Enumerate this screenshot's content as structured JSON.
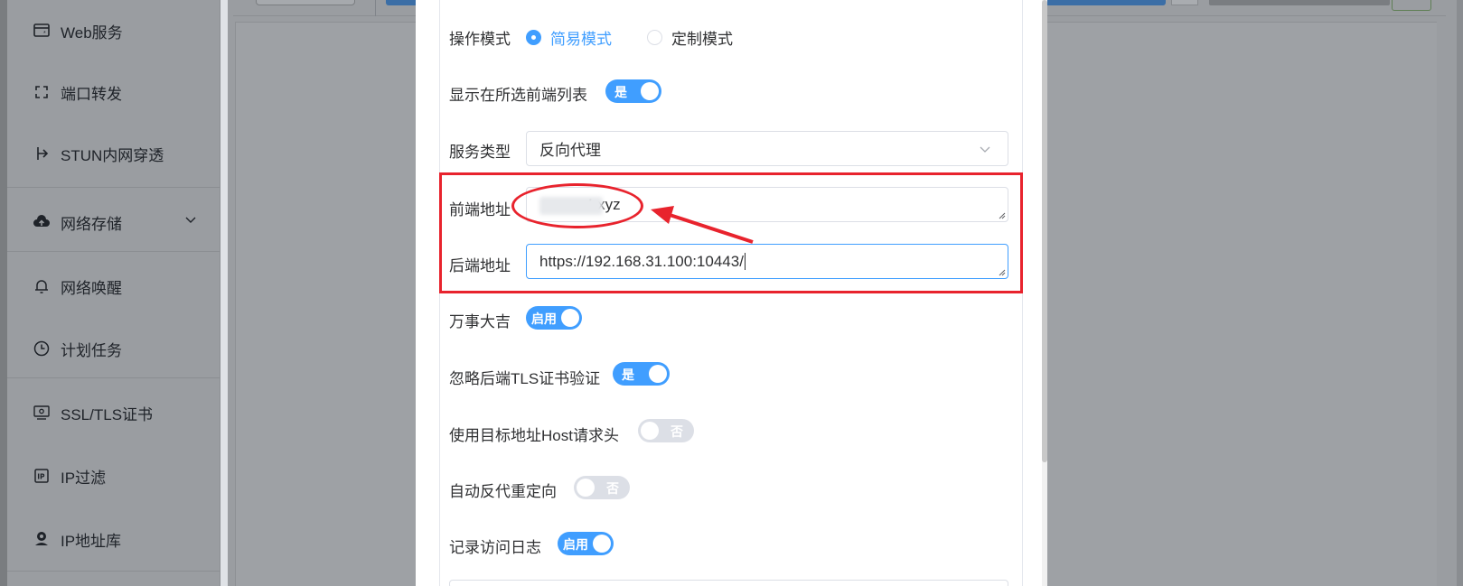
{
  "sidebar": {
    "items": [
      {
        "label": "Web服务",
        "icon": "web-service-icon"
      },
      {
        "label": "端口转发",
        "icon": "port-forward-icon"
      },
      {
        "label": "STUN内网穿透",
        "icon": "stun-icon"
      },
      {
        "label": "网络存储",
        "icon": "cloud-upload-icon"
      },
      {
        "label": "网络唤醒",
        "icon": "bell-icon"
      },
      {
        "label": "计划任务",
        "icon": "clock-icon"
      },
      {
        "label": "SSL/TLS证书",
        "icon": "certificate-icon"
      },
      {
        "label": "IP过滤",
        "icon": "ip-filter-icon"
      },
      {
        "label": "IP地址库",
        "icon": "ip-database-icon"
      }
    ]
  },
  "form": {
    "mode": {
      "label": "操作模式",
      "options": [
        {
          "label": "简易模式",
          "checked": true
        },
        {
          "label": "定制模式",
          "checked": false
        }
      ]
    },
    "show_in_list": {
      "label": "显示在所选前端列表",
      "value": "是",
      "on": true
    },
    "service_type": {
      "label": "服务类型",
      "value": "反向代理"
    },
    "frontend_address": {
      "label": "前端地址",
      "value_visible": "4.xyz"
    },
    "backend_address": {
      "label": "后端地址",
      "value": "https://192.168.31.100:10443/"
    },
    "all_good": {
      "label": "万事大吉",
      "value": "启用",
      "on": true
    },
    "ignore_tls": {
      "label": "忽略后端TLS证书验证",
      "value": "是",
      "on": true
    },
    "use_target_host": {
      "label": "使用目标地址Host请求头",
      "value": "否",
      "on": false
    },
    "auto_redirect": {
      "label": "自动反代重定向",
      "value": "否",
      "on": false
    },
    "access_log": {
      "label": "记录访问日志",
      "value": "启用",
      "on": true
    }
  },
  "colors": {
    "accent": "#409eff",
    "annotation": "#e8232d",
    "switch_off": "#dcdfe6"
  }
}
